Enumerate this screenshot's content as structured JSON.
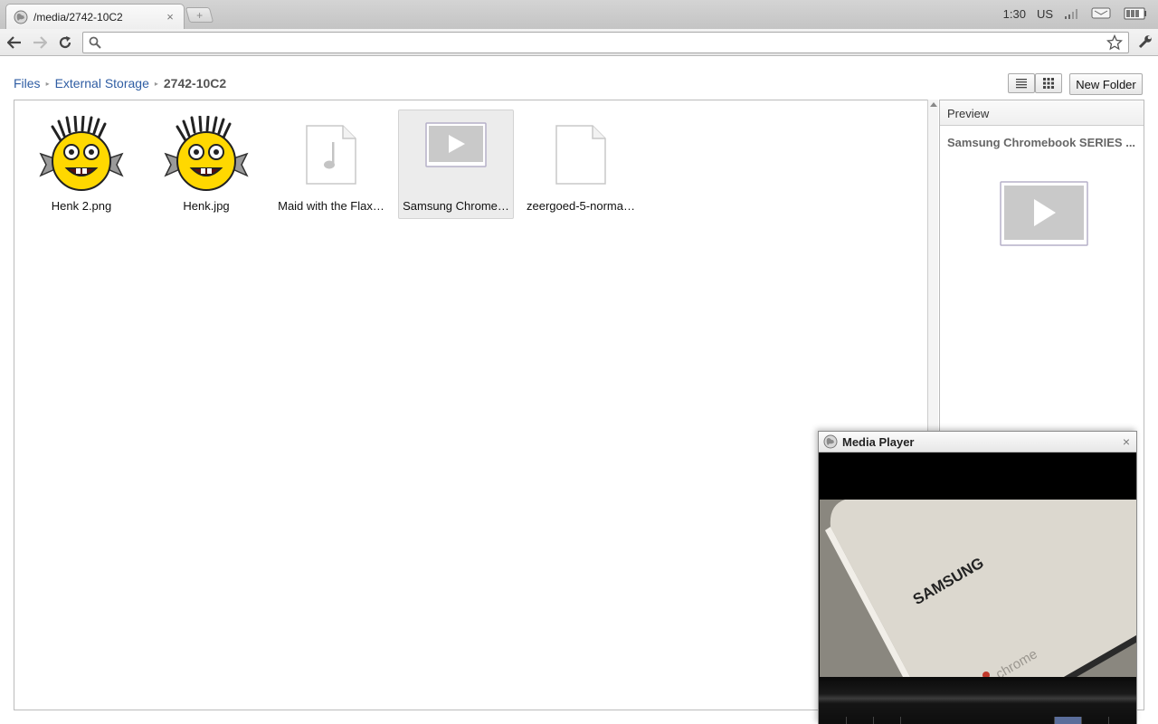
{
  "browser": {
    "tab_title": "/media/2742-10C2",
    "tab_close": "×",
    "new_tab": "+",
    "address_value": "",
    "address_placeholder": ""
  },
  "system_tray": {
    "time": "1:30",
    "input_method": "US"
  },
  "file_manager": {
    "breadcrumb": [
      {
        "label": "Files"
      },
      {
        "label": "External Storage"
      },
      {
        "label": "2742-10C2"
      }
    ],
    "separator": "▸",
    "new_folder_label": "New Folder",
    "files": [
      {
        "name": "Henk 2.png",
        "icon": "henk-image-icon"
      },
      {
        "name": "Henk.jpg",
        "icon": "henk-image-icon"
      },
      {
        "name": "Maid with the Flax…",
        "icon": "audio-file-icon"
      },
      {
        "name": "Samsung Chrome…",
        "icon": "video-file-icon",
        "selected": true
      },
      {
        "name": "zeergoed-5-norma…",
        "icon": "generic-file-icon"
      }
    ],
    "preview": {
      "header": "Preview",
      "filename": "Samsung Chromebook SERIES ..."
    }
  },
  "media_player": {
    "title": "Media Player",
    "close": "×",
    "video_text": {
      "brand": "SAMSUNG",
      "chrome": "chrome"
    }
  },
  "colors": {
    "link": "#2f5da3",
    "selected_tile": "#ececec",
    "smiley_yellow": "#ffd800"
  }
}
